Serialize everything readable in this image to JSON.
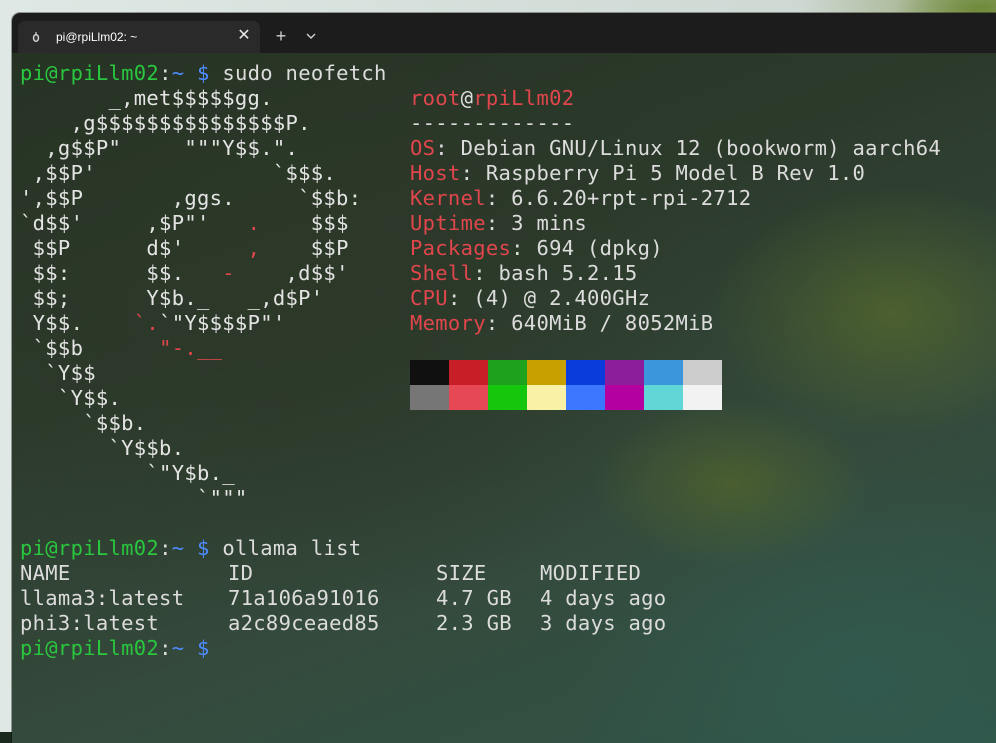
{
  "tab": {
    "title": "pi@rpiLlm02: ~",
    "close_glyph": "✕",
    "new_tab_glyph": "+"
  },
  "prompt": {
    "user_host": "pi@rpiLlm02",
    "sep": ":",
    "path": "~",
    "symbol": "$"
  },
  "commands": {
    "neofetch": "sudo neofetch",
    "ollama": "ollama list"
  },
  "ascii_logo": [
    {
      "white": "       _,met$$$$$gg.",
      "red": ""
    },
    {
      "white": "    ,g$$$$$$$$$$$$$$$P.",
      "red": ""
    },
    {
      "white": "  ,g$$P\"     \"\"\"Y$$.\".",
      "red": ""
    },
    {
      "white": " ,$$P'              `$$$.",
      "red": ""
    },
    {
      "white": "',$$P       ,ggs.     `$$b:",
      "red": ""
    },
    {
      "white_a": "`d$$'     ,$P\"'   ",
      "red": ".",
      "white_b": "    $$$"
    },
    {
      "white_a": " $$P      d$'     ",
      "red": ",",
      "white_b": "    $$P"
    },
    {
      "white_a": " $$:      $$.   ",
      "red": "-",
      "white_b": "    ,d$$'"
    },
    {
      "white_a": " $$;      Y$b._   _,d$P'",
      "red": "",
      "white_b": ""
    },
    {
      "white_a": " Y$$.    ",
      "red": "`.",
      "white_b": "`\"Y$$$$P\"'"
    },
    {
      "white_a": " `$$b      ",
      "red": "\"-.__",
      "white_b": ""
    },
    {
      "white_a": "  `Y$$",
      "red": "",
      "white_b": ""
    },
    {
      "white_a": "   `Y$$.",
      "red": "",
      "white_b": ""
    },
    {
      "white_a": "     `$$b.",
      "red": "",
      "white_b": ""
    },
    {
      "white_a": "       `Y$$b.",
      "red": "",
      "white_b": ""
    },
    {
      "white_a": "          `\"Y$b._",
      "red": "",
      "white_b": ""
    },
    {
      "white_a": "              `\"\"\"",
      "red": "",
      "white_b": ""
    }
  ],
  "sysinfo": {
    "header_user": "root",
    "header_at": "@",
    "header_host": "rpiLlm02",
    "underline": "-------------",
    "rows": [
      {
        "key": "OS",
        "value": "Debian GNU/Linux 12 (bookworm) aarch64"
      },
      {
        "key": "Host",
        "value": "Raspberry Pi 5 Model B Rev 1.0"
      },
      {
        "key": "Kernel",
        "value": "6.6.20+rpt-rpi-2712"
      },
      {
        "key": "Uptime",
        "value": "3 mins"
      },
      {
        "key": "Packages",
        "value": "694 (dpkg)"
      },
      {
        "key": "Shell",
        "value": "bash 5.2.15"
      },
      {
        "key": "CPU",
        "value": "(4) @ 2.400GHz"
      },
      {
        "key": "Memory",
        "value": "640MiB / 8052MiB"
      }
    ],
    "palette_row1": [
      "#101010",
      "#c81e28",
      "#1ea21e",
      "#c8a000",
      "#0a3cdc",
      "#8c1e9b",
      "#3c96dc",
      "#cccccc"
    ],
    "palette_row2": [
      "#767676",
      "#e74856",
      "#16c60c",
      "#f9f1a5",
      "#3b78ff",
      "#b4009e",
      "#61d6d6",
      "#f2f2f2"
    ]
  },
  "ollama_table": {
    "headers": [
      "NAME",
      "ID",
      "SIZE",
      "MODIFIED"
    ],
    "rows": [
      [
        "llama3:latest",
        "71a106a91016",
        "4.7 GB",
        "4 days ago"
      ],
      [
        "phi3:latest",
        "a2c89ceaed85",
        "2.3 GB",
        "3 days ago"
      ]
    ]
  }
}
